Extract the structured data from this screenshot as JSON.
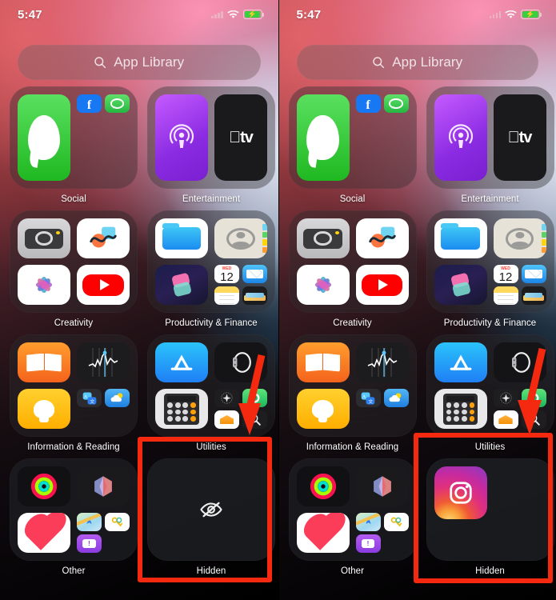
{
  "screenshot": {
    "description": "Side-by-side comparison of iOS App Library Hidden folder",
    "accent_red": "#f5290f",
    "panel_count": 2
  },
  "status_bar": {
    "time": "5:47",
    "signal_icon": "cellular-signal-icon",
    "wifi_icon": "wifi-icon",
    "battery_icon": "battery-charging-icon",
    "battery_charging": true,
    "battery_color": "#37d13f"
  },
  "search": {
    "placeholder": "App Library",
    "icon": "search-icon"
  },
  "folders": [
    {
      "name": "Social",
      "apps": [
        "Messages"
      ],
      "cluster": [
        "Facebook",
        "WhatsApp"
      ]
    },
    {
      "name": "Entertainment",
      "apps": [
        "Podcasts",
        "Apple TV"
      ],
      "cluster": []
    },
    {
      "name": "Creativity",
      "apps": [
        "Camera",
        "Freeform",
        "Photos",
        "YouTube"
      ],
      "cluster": []
    },
    {
      "name": "Productivity & Finance",
      "apps": [
        "Files",
        "Contacts",
        "Shortcuts"
      ],
      "cluster": [
        "Calendar",
        "Mail",
        "Notes",
        "Wallet"
      ]
    },
    {
      "name": "Information & Reading",
      "apps": [
        "Books",
        "Stocks",
        "Tips"
      ],
      "cluster": [
        "Translate",
        "Weather"
      ]
    },
    {
      "name": "Utilities",
      "apps": [
        "App Store",
        "Watch",
        "Calculator"
      ],
      "cluster": [
        "Compass",
        "Find My",
        "Home",
        "Magnifier"
      ]
    },
    {
      "name": "Other",
      "apps": [
        "Fitness",
        "Freeform",
        "Health"
      ],
      "cluster": [
        "Maps",
        "Passwords",
        "Feedback"
      ]
    }
  ],
  "calendar_icon": {
    "day_of_week": "WED",
    "day_number": "12"
  },
  "hidden_folder": {
    "label": "Hidden",
    "left_state": {
      "icon": "eye-slash-icon",
      "apps": [],
      "empty": true
    },
    "right_state": {
      "icon": "instagram-icon",
      "apps": [
        "Instagram"
      ],
      "empty": false
    }
  },
  "annotations": {
    "arrow_icon": "down-arrow-annotation",
    "highlight_box": "red-highlight-box",
    "color": "#f5290f"
  }
}
